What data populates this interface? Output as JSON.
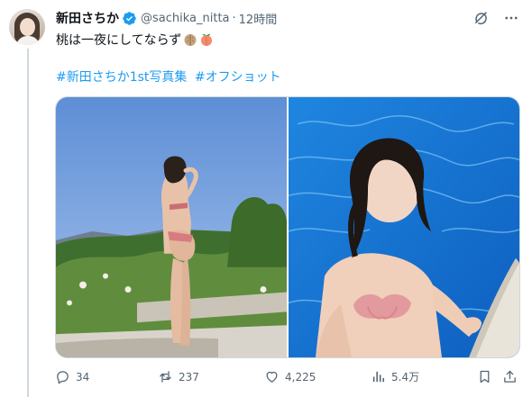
{
  "post": {
    "author_name": "新田さちか",
    "handle": "@sachika_nitta",
    "separator": "·",
    "time": "12時間",
    "text": "桃は一夜にしてならず",
    "emojis": [
      "folded-hands-emoji",
      "peach-emoji"
    ],
    "hashtags": [
      "#新田さちか1st写真集",
      "#オフショット"
    ]
  },
  "media": {
    "count": 2,
    "items": [
      {
        "name": "photo-poolside-standing",
        "description_icon": "photo"
      },
      {
        "name": "photo-in-pool",
        "description_icon": "photo"
      }
    ]
  },
  "actions": {
    "replies": "34",
    "reposts": "237",
    "likes": "4,225",
    "views": "5.4万"
  },
  "icons": {
    "verified": "verified-badge-icon",
    "grok": "grok-icon",
    "more": "more-icon",
    "reply": "reply-icon",
    "repost": "repost-icon",
    "like": "like-icon",
    "views": "views-icon",
    "bookmark": "bookmark-icon",
    "share": "share-icon"
  },
  "colors": {
    "accent": "#1d9bf0",
    "text_primary": "#0f1419",
    "text_secondary": "#536471",
    "border": "#cfd9de"
  }
}
